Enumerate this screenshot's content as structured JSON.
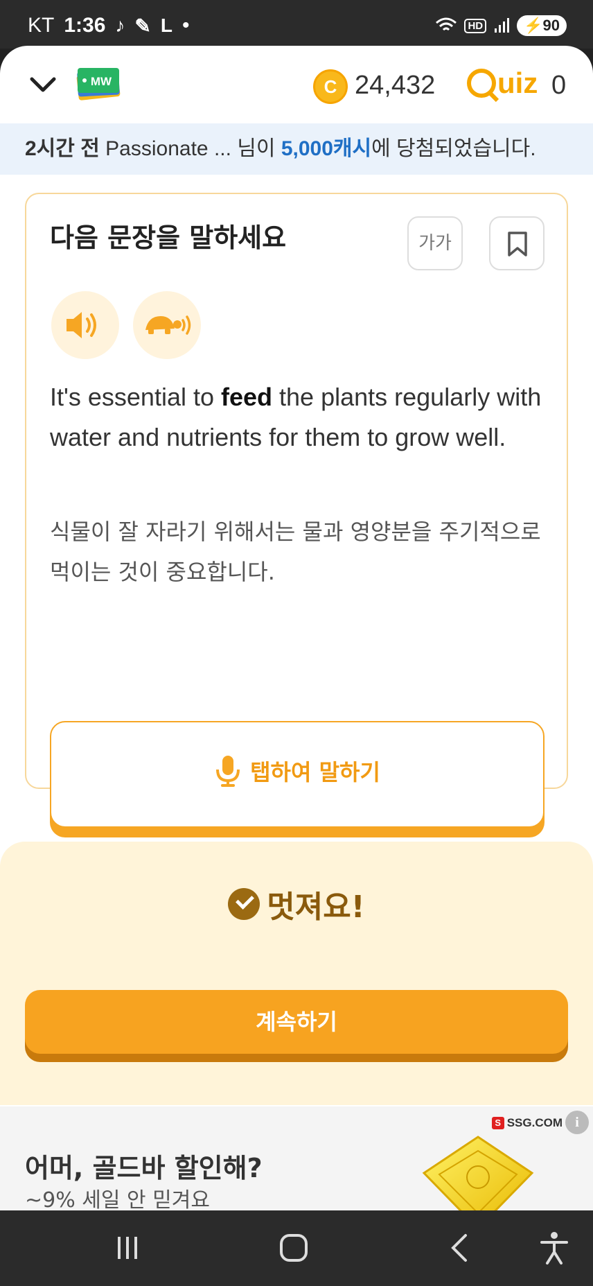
{
  "status_bar": {
    "carrier": "KT",
    "time": "1:36",
    "notif_letter": "L",
    "dot": "•",
    "hd": "HD",
    "battery": "90",
    "icons": [
      "tiktok-icon",
      "pencil-icon",
      "wifi-icon",
      "signal-icon"
    ]
  },
  "header": {
    "logo_text": "MW",
    "coins": "24,432",
    "quiz_logo": "uiz",
    "quiz_count": "0",
    "colors": {
      "accent": "#f6a700",
      "coin": "#f9b81b"
    }
  },
  "notice": {
    "time": "2시간 전",
    "user": "Passionate ...",
    "mid": "님이",
    "amount": "5,000캐시",
    "end": "에 당첨되었습니다."
  },
  "card": {
    "title": "다음 문장을 말하세요",
    "font_button": "가가",
    "sentence_before": "It's essential to ",
    "sentence_keyword": "feed",
    "sentence_after": " the plants regularly with water and nutrients for them to grow well.",
    "translation": "식물이 잘 자라기 위해서는 물과 영양분을 주기적으로 먹이는 것이 중요합니다.",
    "speak_button": "탭하여 말하기"
  },
  "result": {
    "message": "멋져요!",
    "continue_button": "계속하기",
    "colors": {
      "bg": "#fff4d9",
      "button": "#f7a320"
    }
  },
  "ad": {
    "title": "어머, 골드바 할인해?",
    "subtitle": "~9% 세일 안 믿겨요",
    "brand": "SSG.COM",
    "brand_mark": "S",
    "info": "i"
  },
  "navbar": {
    "icons": [
      "recent-apps-icon",
      "home-icon",
      "back-icon",
      "accessibility-icon"
    ]
  }
}
